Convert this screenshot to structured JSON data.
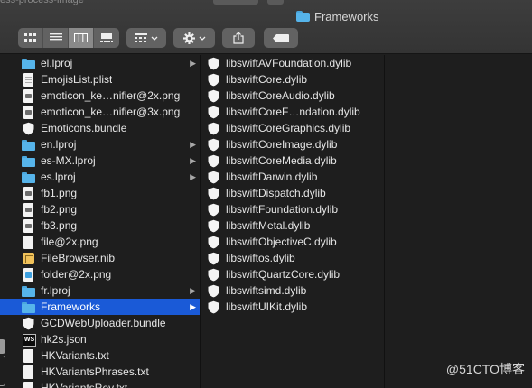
{
  "window": {
    "title": "Frameworks",
    "partial_title_text": "ess-process-image"
  },
  "toolbar": {
    "view_buttons": [
      {
        "icon": "icon-view-icon",
        "active": false
      },
      {
        "icon": "list-view-icon",
        "active": false
      },
      {
        "icon": "column-view-icon",
        "active": true
      },
      {
        "icon": "gallery-view-icon",
        "active": false
      }
    ],
    "group_icon": "group-by-icon",
    "action_icon": "gear-icon",
    "share_icon": "share-icon",
    "tag_icon": "tag-icon"
  },
  "left_column": [
    {
      "label": "el.lproj",
      "icon": "folder",
      "arrow": true
    },
    {
      "label": "EmojisList.plist",
      "icon": "doc",
      "arrow": false
    },
    {
      "label": "emoticon_ke…nifier@2x.png",
      "icon": "img",
      "arrow": false
    },
    {
      "label": "emoticon_ke…nifier@3x.png",
      "icon": "img",
      "arrow": false
    },
    {
      "label": "Emoticons.bundle",
      "icon": "shield",
      "arrow": false
    },
    {
      "label": "en.lproj",
      "icon": "folder",
      "arrow": true
    },
    {
      "label": "es-MX.lproj",
      "icon": "folder",
      "arrow": true
    },
    {
      "label": "es.lproj",
      "icon": "folder",
      "arrow": true
    },
    {
      "label": "fb1.png",
      "icon": "img",
      "arrow": false
    },
    {
      "label": "fb2.png",
      "icon": "img",
      "arrow": false
    },
    {
      "label": "fb3.png",
      "icon": "img",
      "arrow": false
    },
    {
      "label": "file@2x.png",
      "icon": "blank",
      "arrow": false
    },
    {
      "label": "FileBrowser.nib",
      "icon": "nib",
      "arrow": false
    },
    {
      "label": "folder@2x.png",
      "icon": "imgblue",
      "arrow": false
    },
    {
      "label": "fr.lproj",
      "icon": "folder",
      "arrow": true
    },
    {
      "label": "Frameworks",
      "icon": "folder",
      "arrow": true,
      "selected": true
    },
    {
      "label": "GCDWebUploader.bundle",
      "icon": "shield",
      "arrow": false
    },
    {
      "label": "hk2s.json",
      "icon": "json",
      "arrow": false
    },
    {
      "label": "HKVariants.txt",
      "icon": "blank",
      "arrow": false
    },
    {
      "label": "HKVariantsPhrases.txt",
      "icon": "blank",
      "arrow": false
    },
    {
      "label": "HKVariantsRev.txt",
      "icon": "blank",
      "arrow": false
    }
  ],
  "middle_column": [
    "libswiftAVFoundation.dylib",
    "libswiftCore.dylib",
    "libswiftCoreAudio.dylib",
    "libswiftCoreF…ndation.dylib",
    "libswiftCoreGraphics.dylib",
    "libswiftCoreImage.dylib",
    "libswiftCoreMedia.dylib",
    "libswiftDarwin.dylib",
    "libswiftDispatch.dylib",
    "libswiftFoundation.dylib",
    "libswiftMetal.dylib",
    "libswiftObjectiveC.dylib",
    "libswiftos.dylib",
    "libswiftQuartzCore.dylib",
    "libswiftsimd.dylib",
    "libswiftUIKit.dylib"
  ],
  "watermark": "@51CTO博客",
  "colors": {
    "selection": "#1a5ad7",
    "folder": "#56b4ea",
    "background": "#1e1e1e"
  }
}
